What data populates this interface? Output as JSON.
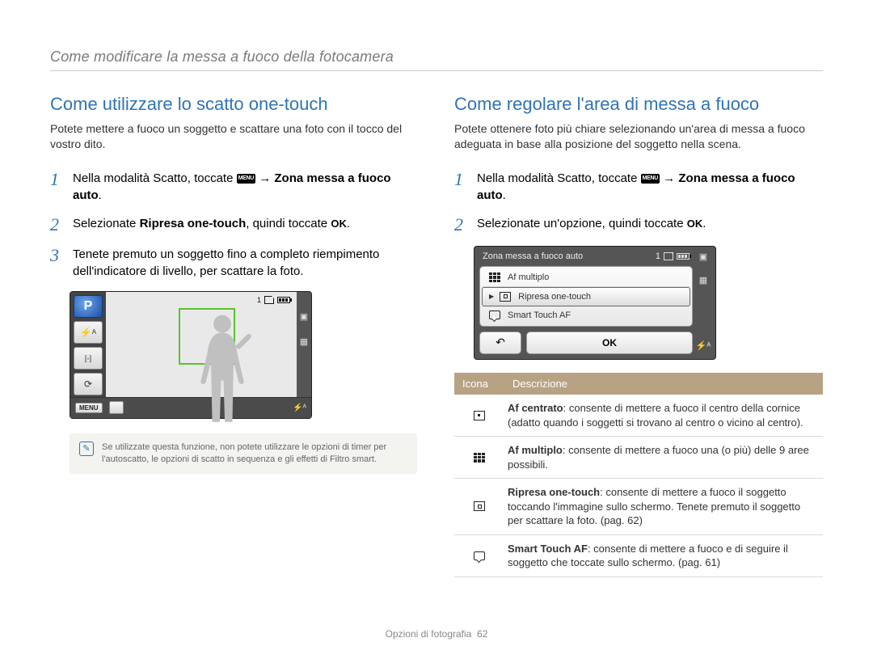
{
  "breadcrumb": "Come modificare la messa a fuoco della fotocamera",
  "left": {
    "heading": "Come utilizzare lo scatto one-touch",
    "lede": "Potete mettere a fuoco un soggetto e scattare una foto con il tocco del vostro dito.",
    "step1_a": "Nella modalità Scatto, toccate ",
    "step1_b": " → ",
    "step1_c": "Zona messa a fuoco auto",
    "step1_d": ".",
    "step2_a": "Selezionate ",
    "step2_b": "Ripresa one-touch",
    "step2_c": ", quindi toccate ",
    "step2_ok": "OK",
    "step2_d": ".",
    "step3": "Tenete premuto un soggetto fino a completo riempimento dell'indicatore di livello, per scattare la foto.",
    "cam": {
      "count": "1",
      "menu": "MENU",
      "flash": "⚡ᴬ"
    },
    "note": "Se utilizzate questa funzione, non potete utilizzare le opzioni di timer per l'autoscatto, le opzioni di scatto in sequenza e gli effetti di Filtro smart."
  },
  "right": {
    "heading": "Come regolare l'area di messa a fuoco",
    "lede": "Potete ottenere foto più chiare selezionando un'area di messa a fuoco adeguata in base alla posizione del soggetto nella scena.",
    "step1_a": "Nella modalità Scatto, toccate ",
    "step1_b": " → ",
    "step1_c": "Zona messa a fuoco auto",
    "step1_d": ".",
    "step2_a": "Selezionate un'opzione, quindi toccate ",
    "step2_ok": "OK",
    "step2_b": ".",
    "dlg": {
      "title": "Zona messa a fuoco auto",
      "count": "1",
      "opt1": "Af multiplo",
      "opt2": "Ripresa one-touch",
      "opt3": "Smart Touch AF",
      "ok": "OK",
      "flash": "⚡ᴬ"
    },
    "table": {
      "h1": "Icona",
      "h2": "Descrizione",
      "rows": [
        {
          "title": "Af centrato",
          "desc": ": consente di mettere a fuoco il centro della cornice (adatto quando i soggetti si trovano al centro o vicino al centro)."
        },
        {
          "title": "Af multiplo",
          "desc": ": consente di mettere a fuoco una (o più) delle 9 aree possibili."
        },
        {
          "title": "Ripresa one-touch",
          "desc": ": consente di mettere a fuoco il soggetto toccando l'immagine sullo schermo. Tenete premuto il soggetto per scattare la foto. (pag. 62)"
        },
        {
          "title": "Smart Touch AF",
          "desc": ": consente di mettere a fuoco e di seguire il soggetto che toccate sullo schermo. (pag. 61)"
        }
      ]
    }
  },
  "footer_a": "Opzioni di fotografia",
  "footer_b": "62"
}
